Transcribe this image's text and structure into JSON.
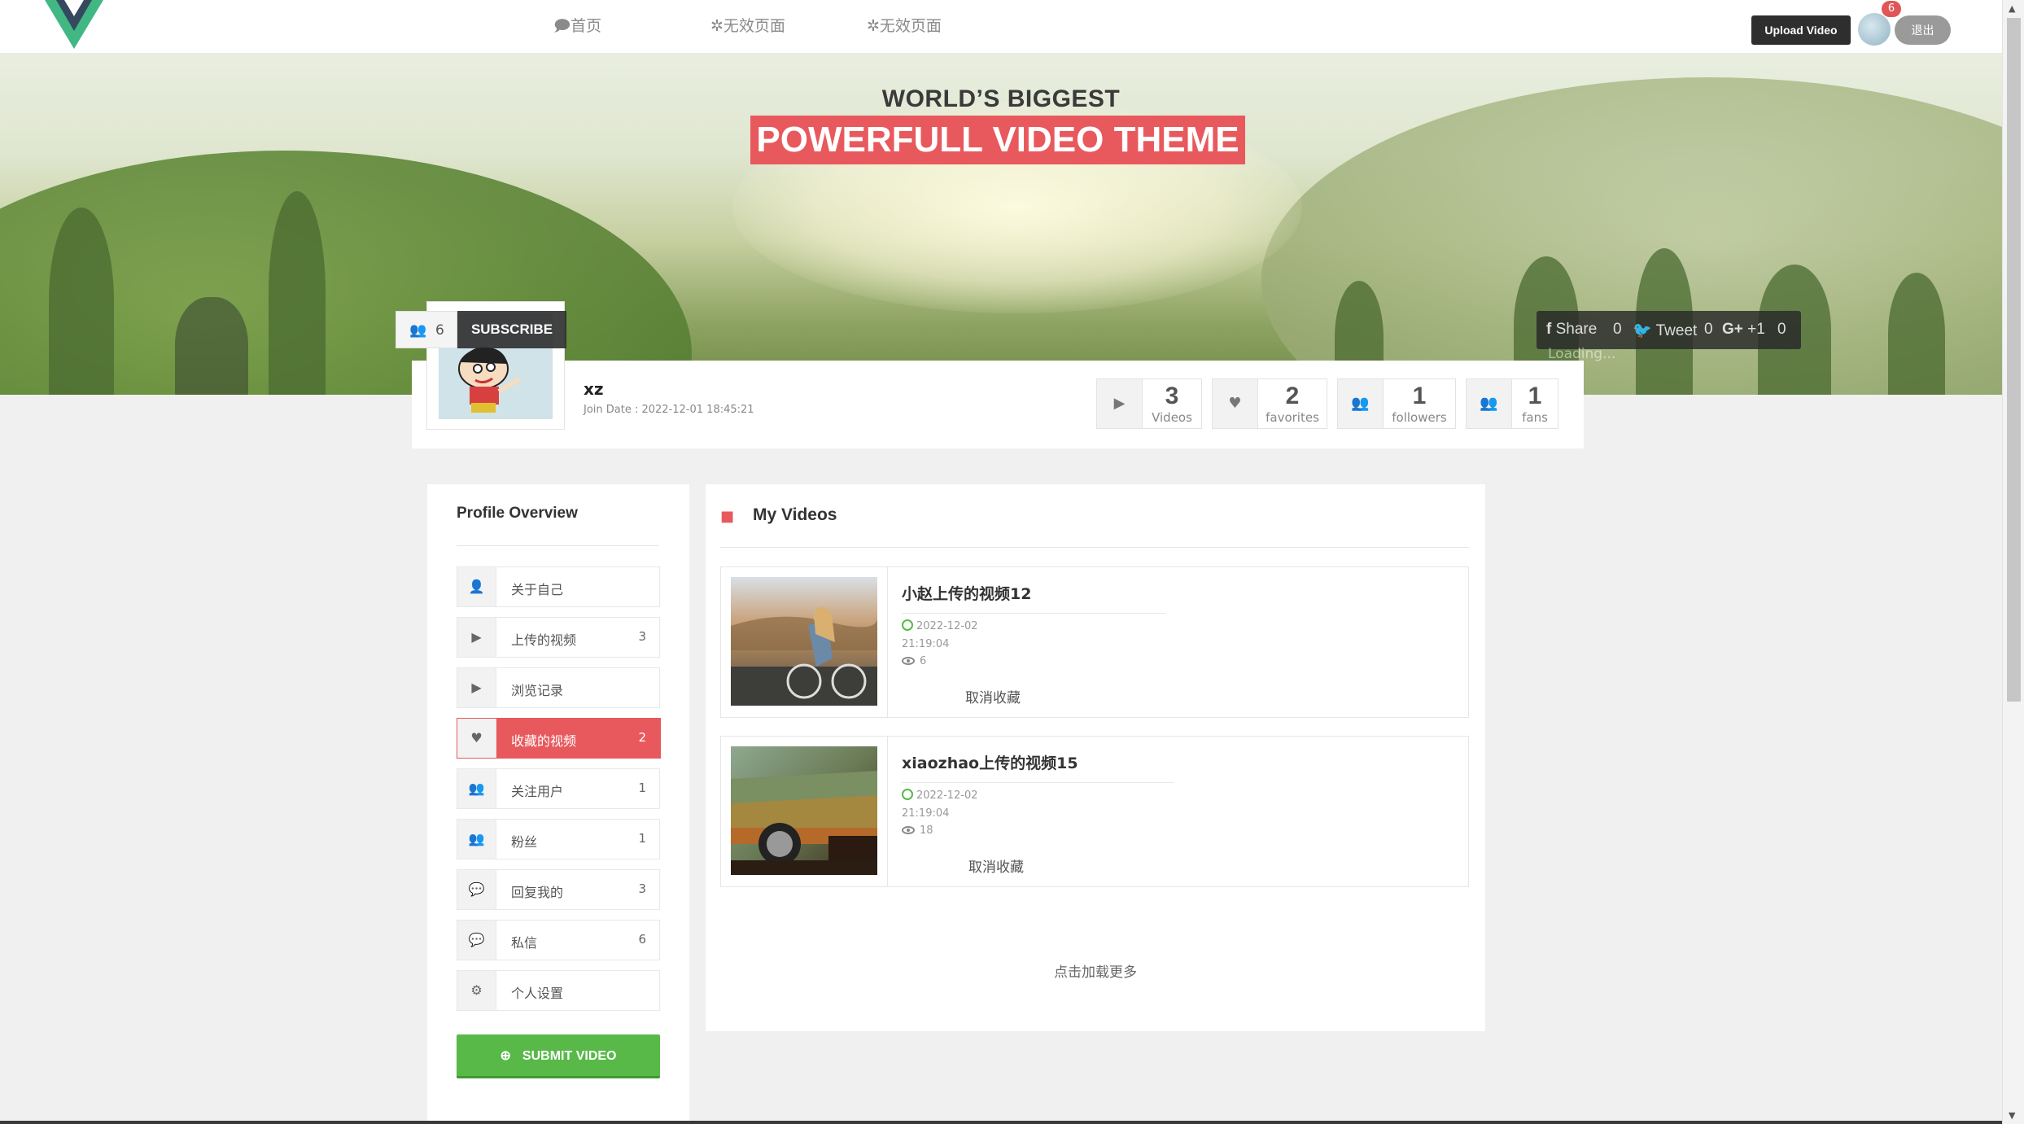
{
  "nav": {
    "links": [
      "🗩首页",
      "✲无效页面",
      "✲无效页面"
    ],
    "upload_label": "Upload Video",
    "notification_count": "6",
    "logout_label": "退出"
  },
  "banner": {
    "headline_small": "WORLD’S BIGGEST",
    "headline_big": "POWERFULL VIDEO THEME"
  },
  "share": {
    "share_label": "Share",
    "share_count": "0",
    "tweet_label": "Tweet",
    "tweet_count": "0",
    "gplus_label": "+1",
    "gplus_count": "0",
    "loading": "Loading..."
  },
  "profile": {
    "subscriber_count": "6",
    "subscribe_label": "SUBSCRIBE",
    "username": "xz",
    "join_date": "Join Date : 2022-12-01 18:45:21",
    "stats": [
      {
        "icon": "video-camera-icon",
        "value": "3",
        "label": "Videos"
      },
      {
        "icon": "heart-icon",
        "value": "2",
        "label": "favorites"
      },
      {
        "icon": "users-icon",
        "value": "1",
        "label": "followers"
      },
      {
        "icon": "users-icon",
        "value": "1",
        "label": "fans"
      }
    ]
  },
  "sidebar": {
    "title": "Profile Overview",
    "items": [
      {
        "icon": "user-icon",
        "label": "关于自己",
        "count": ""
      },
      {
        "icon": "video-camera-icon",
        "label": "上传的视频",
        "count": "3"
      },
      {
        "icon": "video-camera-icon",
        "label": "浏览记录",
        "count": ""
      },
      {
        "icon": "heart-icon",
        "label": "收藏的视频",
        "count": "2",
        "active": true
      },
      {
        "icon": "users-icon",
        "label": "关注用户",
        "count": "1"
      },
      {
        "icon": "users-icon",
        "label": "粉丝",
        "count": "1"
      },
      {
        "icon": "comments-icon",
        "label": "回复我的",
        "count": "3"
      },
      {
        "icon": "comments-icon",
        "label": "私信",
        "count": "6"
      },
      {
        "icon": "gears-icon",
        "label": "个人设置",
        "count": ""
      }
    ],
    "submit_label": "SUBMIT VIDEO"
  },
  "main": {
    "title": "My Videos",
    "videos": [
      {
        "title": "小赵上传的视频12",
        "date": "2022-12-02",
        "time": "21:19:04",
        "views": "6",
        "action": "取消收藏"
      },
      {
        "title": "xiaozhao上传的视频15",
        "date": "2022-12-02",
        "time": "21:19:04",
        "views": "18",
        "action": "取消收藏"
      }
    ],
    "load_more": "点击加载更多"
  },
  "colors": {
    "accent": "#e8595d",
    "green": "#58b948",
    "dark": "#2e2e2e"
  }
}
